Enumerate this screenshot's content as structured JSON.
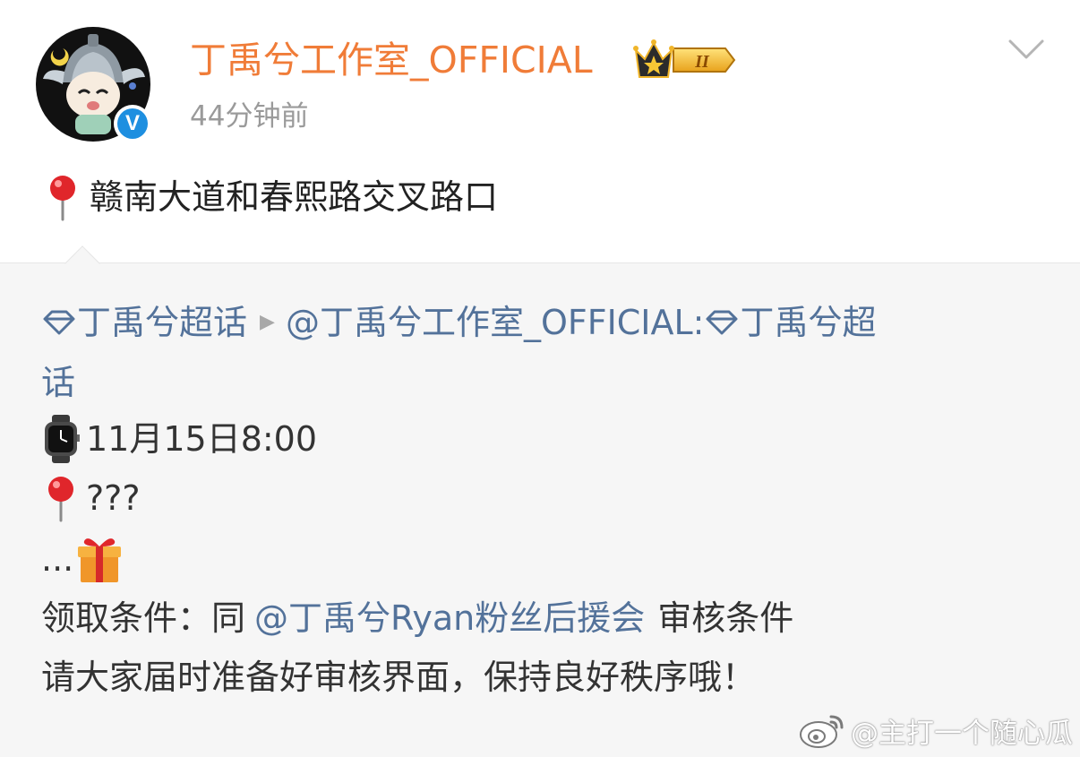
{
  "header": {
    "username": "丁禹兮工作室_OFFICIAL",
    "time": "44分钟前",
    "badge_level": "II",
    "verified_mark": "V"
  },
  "post": {
    "text": "赣南大道和春熙路交叉路口",
    "icon": "round-pushpin-icon"
  },
  "repost": {
    "topic": "丁禹兮超话",
    "author_link": "@丁禹兮工作室_OFFICIAL:",
    "topic_inline": "丁禹兮超",
    "topic_wrap": "话",
    "time_line": "11月15日8:00",
    "location_line": "???",
    "gift_line": "...",
    "condition_label": "领取条件：同",
    "condition_link": "@丁禹兮Ryan粉丝后援会",
    "condition_tail": "审核条件",
    "notice": "请大家届时准备好审核界面，保持良好秩序哦！"
  },
  "watermark": {
    "text": "@主打一个随心瓜"
  },
  "colors": {
    "username": "#f07c38",
    "link": "#53729a",
    "timestamp": "#9a9a9a",
    "repost_bg": "#f6f6f6",
    "verified": "#1e8fe0"
  }
}
